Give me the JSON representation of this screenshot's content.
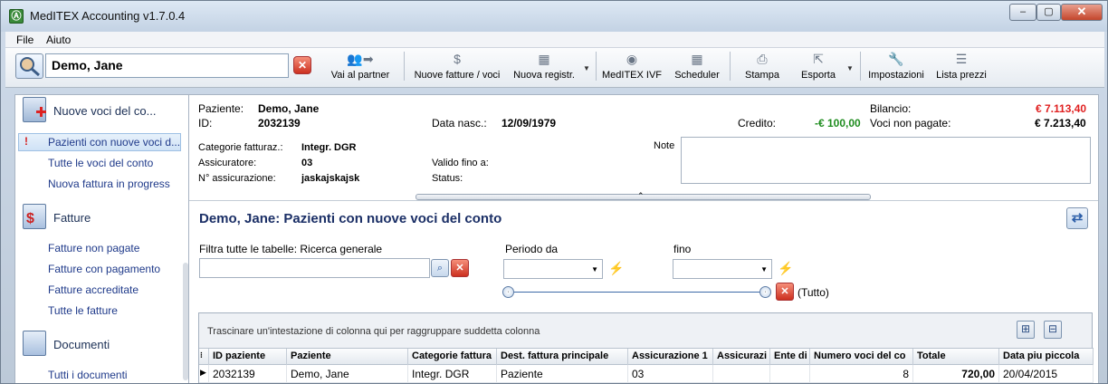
{
  "window": {
    "title": "MedITEX Accounting v1.7.0.4",
    "controls": {
      "minimize": "–",
      "maximize": "▢",
      "close": "✕"
    }
  },
  "menu": [
    "File",
    "Aiuto"
  ],
  "toolbar": {
    "patient_name": "Demo, Jane",
    "buttons": {
      "vai_partner": "Vai al partner",
      "nuove_fatture": "Nuove fatture / voci",
      "nuova_registr": "Nuova registr.",
      "meditex_ivf": "MedITEX IVF",
      "scheduler": "Scheduler",
      "stampa": "Stampa",
      "esporta": "Esporta",
      "impostazioni": "Impostazioni",
      "lista_prezzi": "Lista prezzi"
    }
  },
  "sidebar": {
    "sections": [
      {
        "title": "Nuove voci del co...",
        "icon": "document-plus-icon",
        "items": [
          "Pazienti con nuove voci d...",
          "Tutte le voci del conto",
          "Nuova fattura in progress"
        ]
      },
      {
        "title": "Fatture",
        "icon": "invoice-icon",
        "items": [
          "Fatture non pagate",
          "Fatture con pagamento",
          "Fatture accreditate",
          "Tutte le fatture"
        ]
      },
      {
        "title": "Documenti",
        "icon": "documents-icon",
        "items": [
          "Tutti i documenti"
        ]
      }
    ],
    "selected_marker": "!"
  },
  "patient": {
    "paziente_label": "Paziente:",
    "paziente_value": "Demo, Jane",
    "id_label": "ID:",
    "id_value": "2032139",
    "dob_label": "Data nasc.:",
    "dob_value": "12/09/1979",
    "credito_label": "Credito:",
    "credito_value": "-€ 100,00",
    "bilancio_label": "Bilancio:",
    "bilancio_value": "€ 7.113,40",
    "voci_label": "Voci non pagate:",
    "voci_value": "€ 7.213,40",
    "categorie_label": "Categorie fatturaz.:",
    "categorie_value": "Integr. DGR",
    "assicuratore_label": "Assicuratore:",
    "assicuratore_value": "03",
    "num_ass_label": "N° assicurazione:",
    "num_ass_value": "jaskajskajsk",
    "valido_label": "Valido fino a:",
    "status_label": "Status:",
    "note_label": "Note",
    "colors": {
      "credit": "#1e8c1e",
      "balance": "#e02020"
    }
  },
  "content": {
    "heading": "Demo, Jane:   Pazienti con nuove voci del conto",
    "filter_label": "Filtra tutte le tabelle:  Ricerca generale",
    "periodo_label": "Periodo da",
    "fino_label": "fino",
    "tutto_label": "(Tutto)"
  },
  "grid": {
    "group_hint": "Trascinare un'intestazione di colonna qui per raggruppare suddetta colonna",
    "columns": [
      "ID paziente",
      "Paziente",
      "Categorie fattura",
      "Dest. fattura principale",
      "Assicurazione 1",
      "Assicurazi",
      "Ente di",
      "Numero voci del co",
      "Totale",
      "Data piu piccola"
    ],
    "rows": [
      [
        "2032139",
        "Demo, Jane",
        "Integr. DGR",
        "Paziente",
        "03",
        "",
        "",
        "8",
        "720,00",
        "20/04/2015"
      ]
    ]
  }
}
